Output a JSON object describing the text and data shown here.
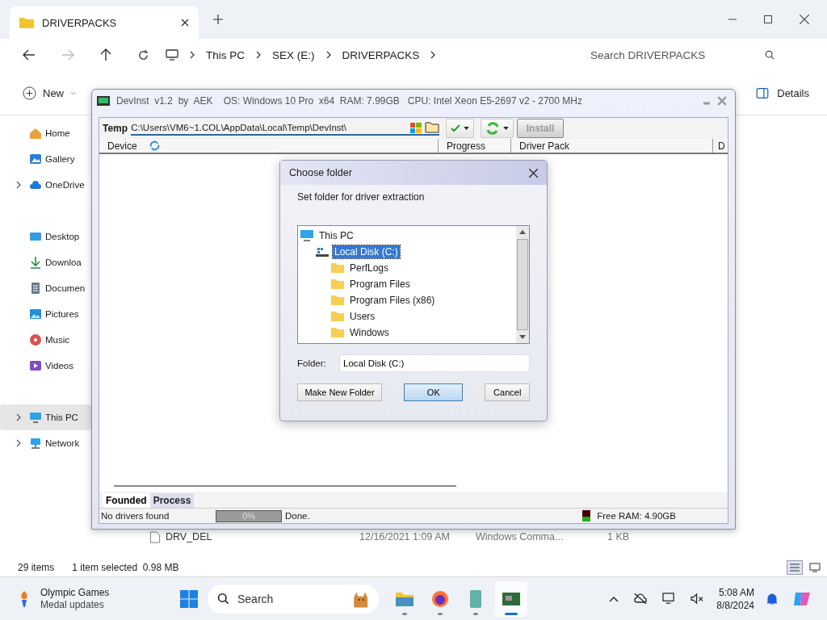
{
  "explorer": {
    "tab": {
      "title": "DRIVERPACKS"
    },
    "nav": {
      "back": {
        "disabled": false
      },
      "forward": {
        "disabled": true
      }
    },
    "breadcrumbs": [
      "This PC",
      "SEX (E:)",
      "DRIVERPACKS"
    ],
    "search": {
      "placeholder": "Search DRIVERPACKS"
    },
    "commands": {
      "new": "New",
      "details": "Details"
    },
    "sidebar": {
      "sections": [
        {
          "items": [
            {
              "label": "Home",
              "kind": "home",
              "expandable": false,
              "selected": false
            },
            {
              "label": "Gallery",
              "kind": "gallery",
              "expandable": false,
              "selected": false
            },
            {
              "label": "OneDrive",
              "kind": "cloud",
              "expandable": true,
              "selected": false
            }
          ]
        },
        {
          "items": [
            {
              "label": "Desktop",
              "kind": "desktop",
              "expandable": false,
              "selected": false
            },
            {
              "label": "Downloa",
              "kind": "download",
              "expandable": false,
              "selected": false
            },
            {
              "label": "Documen",
              "kind": "documents",
              "expandable": false,
              "selected": false
            },
            {
              "label": "Pictures",
              "kind": "pictures",
              "expandable": false,
              "selected": false
            },
            {
              "label": "Music",
              "kind": "music",
              "expandable": false,
              "selected": false
            },
            {
              "label": "Videos",
              "kind": "videos",
              "expandable": false,
              "selected": false
            }
          ]
        },
        {
          "items": [
            {
              "label": "This PC",
              "kind": "pc",
              "expandable": true,
              "selected": true
            },
            {
              "label": "Network",
              "kind": "network",
              "expandable": true,
              "selected": false
            }
          ]
        }
      ]
    },
    "files": [
      {
        "name": "DRV_DEL",
        "date": "12/16/2021 1:09 AM",
        "type": "Windows Comma...",
        "size": "1 KB"
      }
    ],
    "status_bar": {
      "count": "29 items",
      "selection": "1 item selected  0.98 MB"
    }
  },
  "devinst": {
    "title": "DevInst  v1.2  by  AEK    OS: Windows 10 Pro  x64  RAM: 7.99GB   CPU: Intel Xeon E5-2697 v2 - 2700 MHz",
    "temp_label": "Temp",
    "temp_path": "C:\\Users\\VM6~1.COL\\AppData\\Local\\Temp\\DevInst\\",
    "install": {
      "label": "Install",
      "disabled": true
    },
    "columns": [
      "Device",
      "Progress",
      "Driver Pack",
      "D"
    ],
    "tabs": [
      {
        "label": "Founded",
        "selected": true
      },
      {
        "label": "Process",
        "selected": false
      }
    ],
    "status": {
      "message": "No drivers found",
      "progress": {
        "level": 0,
        "reading": "0%"
      },
      "state": "Done.",
      "free_ram": "Free RAM: 4.90GB"
    }
  },
  "dialog": {
    "title": "Choose folder",
    "prompt": "Set folder for driver extraction",
    "tree": [
      {
        "label": "This PC",
        "kind": "pc",
        "selected": false,
        "children": [
          {
            "label": "Local Disk (C:)",
            "kind": "drive",
            "selected": true,
            "children": [
              {
                "label": "PerfLogs",
                "kind": "folder",
                "selected": false
              },
              {
                "label": "Program Files",
                "kind": "folder",
                "selected": false
              },
              {
                "label": "Program Files (x86)",
                "kind": "folder",
                "selected": false
              },
              {
                "label": "Users",
                "kind": "folder",
                "selected": false
              },
              {
                "label": "Windows",
                "kind": "folder",
                "selected": false
              }
            ]
          }
        ]
      }
    ],
    "folder_label": "Folder:",
    "folder_value": "Local Disk (C:)",
    "buttons": [
      {
        "label": "Make New Folder",
        "kind": "normal"
      },
      {
        "label": "OK",
        "kind": "default"
      },
      {
        "label": "Cancel",
        "kind": "normal"
      }
    ]
  },
  "taskbar": {
    "news": {
      "title": "Olympic Games",
      "subtitle": "Medal updates"
    },
    "search": {
      "placeholder": "Search"
    },
    "apps": [
      {
        "kind": "files",
        "active": false
      },
      {
        "kind": "browser",
        "active": false
      },
      {
        "kind": "notebook",
        "active": false
      },
      {
        "kind": "board",
        "active": true
      }
    ],
    "time": "5:08 AM",
    "date": "8/8/2024"
  }
}
